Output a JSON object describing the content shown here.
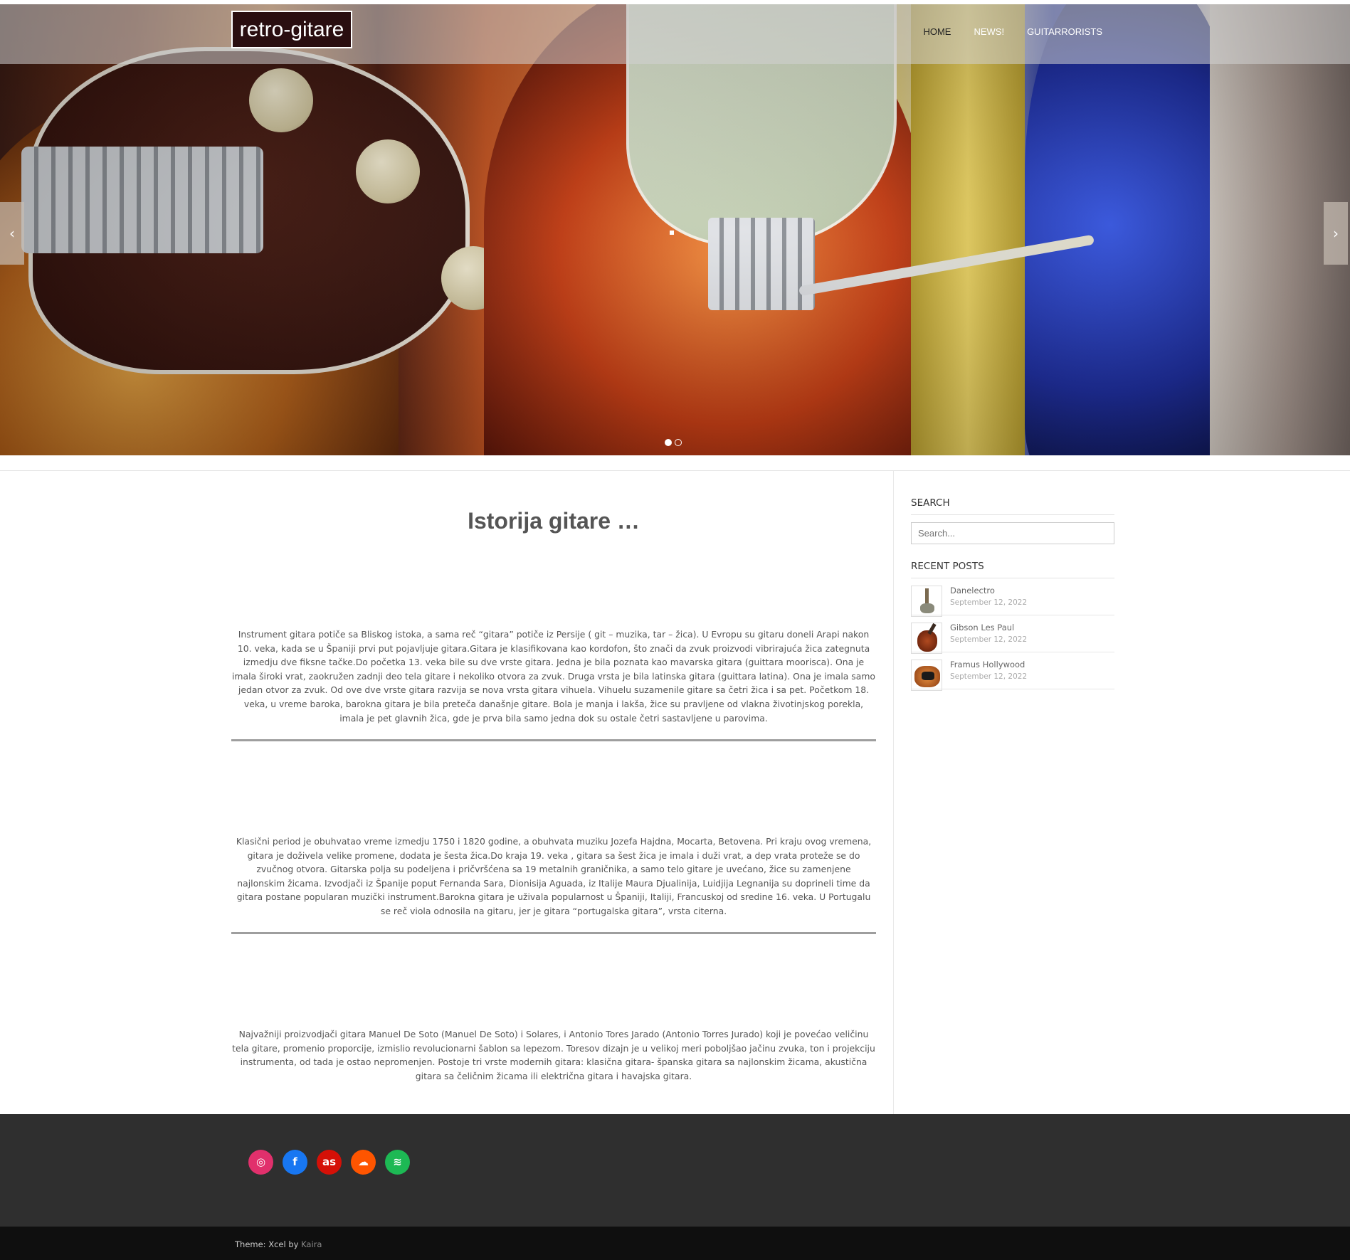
{
  "header": {
    "logo": "retro-gitare",
    "nav": [
      "HOME",
      "NEWS!",
      "GUITARRORISTS"
    ]
  },
  "slider": {
    "prev_icon": "chevron-left-icon",
    "next_icon": "chevron-right-icon",
    "slide_count": 2,
    "active_slide": 1
  },
  "main": {
    "title": "Istorija gitare …",
    "paragraphs": [
      "Instrument gitara potiče sa Bliskog istoka, a sama reč “gitara” potiče iz Persije ( git – muzika, tar – žica). U Evropu su gitaru doneli Arapi nakon 10. veka, kada se u Španiji prvi put pojavljuje gitara.Gitara je klasifikovana kao kordofon, što znači da zvuk proizvodi vibrirajuća žica zategnuta izmedju dve fiksne tačke.Do početka 13. veka bile su dve vrste gitara. Jedna je bila poznata kao mavarska gitara (guittara moorisca). Ona je imala široki vrat, zaokružen zadnji deo tela gitare i nekoliko otvora za zvuk. Druga vrsta je bila latinska gitara (guittara latina). Ona je imala samo jedan otvor za zvuk. Od ove dve vrste gitara razvija se nova vrsta gitara vihuela. Vihuelu suzamenile gitare sa četri žica i sa pet. Početkom 18. veka, u vreme baroka, barokna gitara je bila preteča današnje gitare. Bola je manja i lakša, žice su pravljene od vlakna životinjskog porekla, imala je pet glavnih žica, gde je prva bila samo jedna dok su ostale četri sastavljene u parovima.",
      "Klasični period je obuhvatao vreme izmedju 1750 i 1820 godine, a obuhvata muziku Jozefa Hajdna, Mocarta, Betovena. Pri kraju ovog vremena, gitara je doživela velike promene, dodata je šesta žica.Do kraja 19. veka , gitara sa šest žica je imala i duži vrat, a dep vrata proteže se do zvučnog otvora. Gitarska polja su podeljena i pričvršćena sa 19 metalnih graničnika, a samo telo gitare je uvećano, žice su zamenjene najlonskim žicama. Izvodjači iz Španije poput Fernanda Sara, Dionisija Aguada, iz Italije Maura Djualinija, Luidjija Legnanija su doprineli time da gitara postane popularan muzički instrument.Barokna gitara je uživala popularnost u Španiji, Italiji, Francuskoj od sredine 16. veka. U Portugalu se reč viola odnosila na gitaru, jer je gitara “portugalska gitara”, vrsta citerna.",
      "Najvažniji proizvodjači gitara Manuel De Soto (Manuel De Soto) i Solares, i Antonio Tores Jarado (Antonio Torres Jurado) koji je povećao veličinu tela gitare, promenio proporcije, izmislio revolucionarni šablon sa lepezom. Toresov dizajn je u velikoj meri poboljšao jačinu zvuka, ton i projekciju instrumenta, od tada je ostao nepromenjen. Postoje tri vrste modernih gitara: klasična gitara- španska gitara sa najlonskim žicama, akustična gitara sa čeličnim žicama ili električna gitara i havajska gitara."
    ]
  },
  "sidebar": {
    "search_title": "SEARCH",
    "search_placeholder": "Search...",
    "recent_title": "RECENT POSTS",
    "posts": [
      {
        "title": "Danelectro",
        "date": "September 12, 2022"
      },
      {
        "title": "Gibson Les Paul",
        "date": "September 12, 2022"
      },
      {
        "title": "Framus Hollywood",
        "date": "September 12, 2022"
      }
    ]
  },
  "footer": {
    "social": [
      {
        "name": "instagram-icon",
        "glyph": "◎",
        "color": "#e1306c"
      },
      {
        "name": "facebook-icon",
        "glyph": "f",
        "color": "#1877f2"
      },
      {
        "name": "lastfm-icon",
        "glyph": "as",
        "color": "#d51007"
      },
      {
        "name": "soundcloud-icon",
        "glyph": "☁",
        "color": "#ff5500"
      },
      {
        "name": "spotify-icon",
        "glyph": "≋",
        "color": "#1db954"
      }
    ],
    "credit_prefix": "Theme: Xcel by",
    "credit_link": "Kaira"
  }
}
